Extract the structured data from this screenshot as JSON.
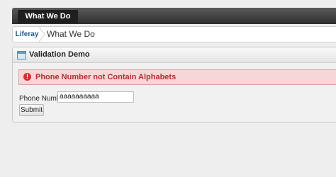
{
  "top_nav": {
    "item": "What We Do"
  },
  "breadcrumb": {
    "home": "Liferay",
    "current": "What We Do"
  },
  "portlet": {
    "title": "Validation Demo",
    "alert": "Phone Number not Contain Alphabets",
    "field_label": "Phone Number:",
    "field_value": "aaaaaaaaaa",
    "submit_label": "Submit"
  },
  "colors": {
    "alert_bg": "#f6d6d6",
    "alert_text": "#b03030",
    "link": "#1f5a8a"
  },
  "icons": {
    "portlet": "window-icon",
    "alert": "error-icon",
    "separator": "chevron-right-icon"
  }
}
